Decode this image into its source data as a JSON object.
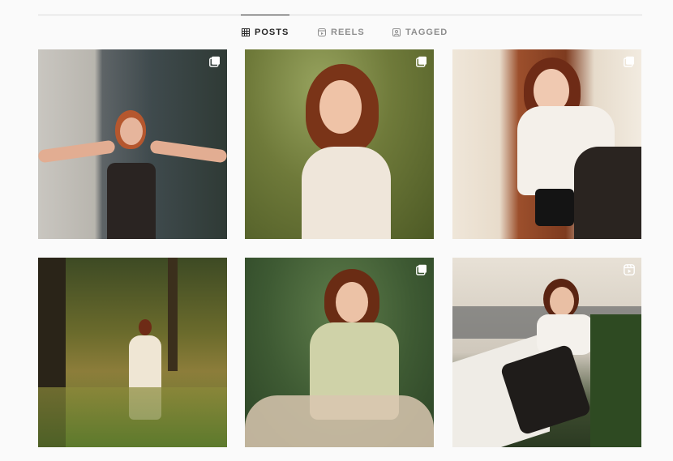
{
  "tabs": [
    {
      "label": "POSTS",
      "icon": "grid-icon",
      "active": true
    },
    {
      "label": "REELS",
      "icon": "reels-icon",
      "active": false
    },
    {
      "label": "TAGGED",
      "icon": "tagged-icon",
      "active": false
    }
  ],
  "colors": {
    "active_text": "#262626",
    "inactive_text": "#8e8e8e",
    "divider": "#dbdbdb",
    "background": "#fafafa"
  },
  "posts": [
    {
      "overlay_icon": "multiple-photos-icon"
    },
    {
      "overlay_icon": "multiple-photos-icon"
    },
    {
      "overlay_icon": "multiple-photos-icon"
    },
    {
      "overlay_icon": ""
    },
    {
      "overlay_icon": "multiple-photos-icon"
    },
    {
      "overlay_icon": "reel-icon"
    }
  ]
}
